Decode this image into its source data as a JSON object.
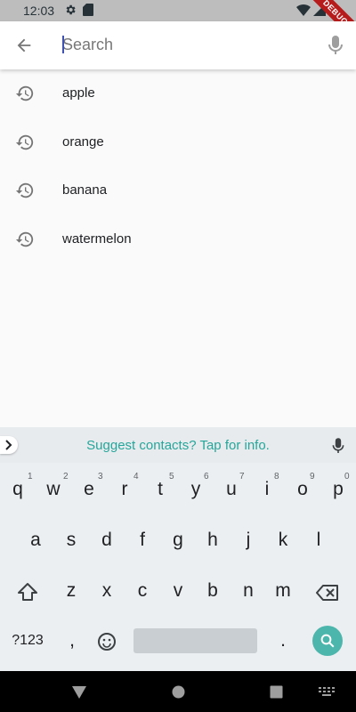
{
  "status_bar": {
    "time": "12:03",
    "debug_label": "DEBUG"
  },
  "search": {
    "placeholder": "Search",
    "value": ""
  },
  "history": [
    {
      "label": "apple"
    },
    {
      "label": "orange"
    },
    {
      "label": "banana"
    },
    {
      "label": "watermelon"
    }
  ],
  "keyboard": {
    "suggestion": "Suggest contacts? Tap for info.",
    "row1": [
      "q",
      "w",
      "e",
      "r",
      "t",
      "y",
      "u",
      "i",
      "o",
      "p"
    ],
    "row1_hints": [
      "1",
      "2",
      "3",
      "4",
      "5",
      "6",
      "7",
      "8",
      "9",
      "0"
    ],
    "row2": [
      "a",
      "s",
      "d",
      "f",
      "g",
      "h",
      "j",
      "k",
      "l"
    ],
    "row3": [
      "z",
      "x",
      "c",
      "v",
      "b",
      "n",
      "m"
    ],
    "symbols_key": "?123",
    "comma_key": ",",
    "period_key": "."
  },
  "colors": {
    "accent": "#26a69a",
    "search_key": "#4db6ac",
    "status_bar": "#bdbdbd"
  }
}
